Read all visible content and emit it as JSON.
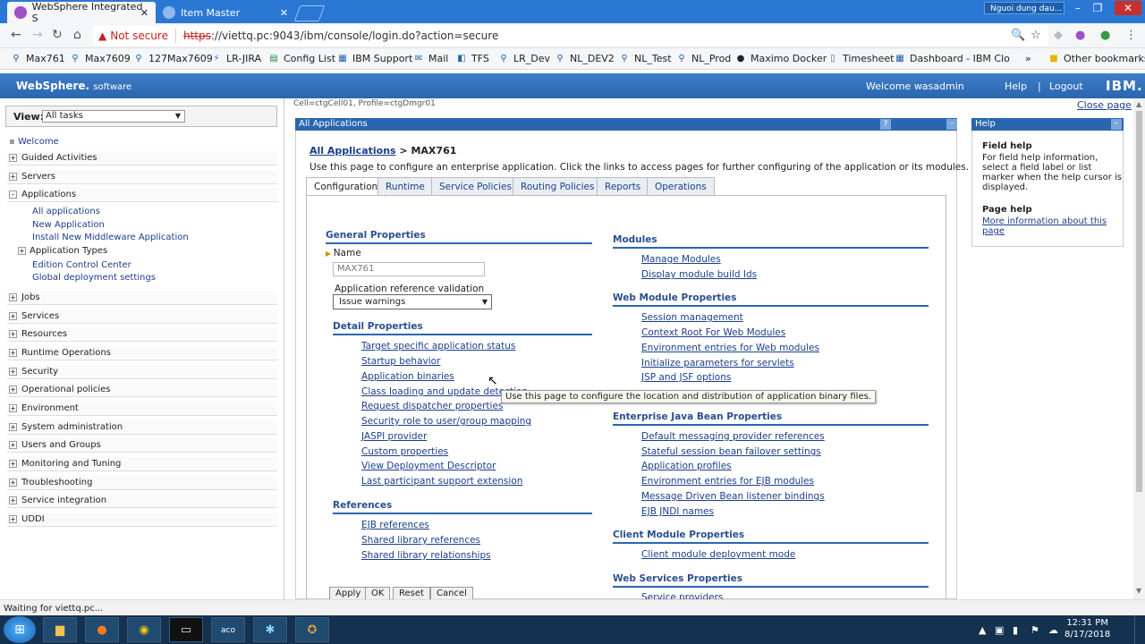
{
  "browser": {
    "tabs": [
      {
        "title": "WebSphere Integrated S",
        "active": true
      },
      {
        "title": "Item Master",
        "active": false
      }
    ],
    "profile_name": "Nguoi dung dau...",
    "security": "Not secure",
    "url_scheme": "https",
    "url_rest": "://viettq.pc:9043/ibm/console/login.do?action=secure",
    "bookmarks": [
      "Max761",
      "Max7609",
      "127Max7609",
      "LR-JIRA",
      "Config List",
      "IBM Support",
      "Mail",
      "TFS",
      "LR_Dev",
      "NL_DEV2",
      "NL_Test",
      "NL_Prod",
      "Maximo Docker",
      "Timesheet",
      "Dashboard - IBM Clo"
    ],
    "other_bookmarks": "Other bookmarks",
    "overflow": "»",
    "status": "Waiting for viettq.pc..."
  },
  "header": {
    "logo": "WebSphere.",
    "logo_sub": "software",
    "welcome": "Welcome wasadmin",
    "help": "Help",
    "divider": "|",
    "logout": "Logout",
    "ibm": "IBM."
  },
  "nav": {
    "view_label": "View:",
    "view_value": "All tasks",
    "welcome": "Welcome",
    "items": [
      "Guided Activities",
      "Servers",
      "Applications",
      "Jobs",
      "Services",
      "Resources",
      "Runtime Operations",
      "Security",
      "Operational policies",
      "Environment",
      "System administration",
      "Users and Groups",
      "Monitoring and Tuning",
      "Troubleshooting",
      "Service integration",
      "UDDI"
    ],
    "app_sub": [
      "All applications",
      "New Application",
      "Install New Middleware Application",
      "Application Types",
      "Edition Control Center",
      "Global deployment settings"
    ]
  },
  "main": {
    "cell_info": "Cell=ctgCell01, Profile=ctgDmgr01",
    "close_page": "Close page",
    "panel_title": "All Applications",
    "panel_help_btn": "?",
    "breadcrumb_link": "All Applications",
    "breadcrumb_rest": " > MAX761",
    "description": "Use this page to configure an enterprise application. Click the links to access pages for further configuring of the application or its modules.",
    "tabs": [
      "Configuration",
      "Runtime",
      "Service Policies",
      "Routing Policies",
      "Reports",
      "Operations"
    ],
    "general_properties": "General Properties",
    "name_label": "Name",
    "name_value": "MAX761",
    "arv_label": "Application reference validation",
    "arv_value": "Issue warnings",
    "detail_properties": "Detail Properties",
    "detail_links": [
      "Target specific application status",
      "Startup behavior",
      "Application binaries",
      "Class loading and update detection",
      "Request dispatcher properties",
      "Security role to user/group mapping",
      "JASPI provider",
      "Custom properties",
      "View Deployment Descriptor",
      "Last participant support extension"
    ],
    "references": "References",
    "reference_links": [
      "EJB references",
      "Shared library references",
      "Shared library relationships"
    ],
    "modules": "Modules",
    "module_links": [
      "Manage Modules",
      "Display module build Ids"
    ],
    "web_module_properties": "Web Module Properties",
    "web_links": [
      "Session management",
      "Context Root For Web Modules",
      "Environment entries for Web modules",
      "Initialize parameters for servlets",
      "JSP and JSF options"
    ],
    "ejb_properties": "Enterprise Java Bean Properties",
    "ejb_links": [
      "Default messaging provider references",
      "Stateful session bean failover settings",
      "Application profiles",
      "Environment entries for EJB modules",
      "Message Driven Bean listener bindings",
      "EJB JNDI names"
    ],
    "client_module_properties": "Client Module Properties",
    "client_links": [
      "Client module deployment mode"
    ],
    "web_services_properties": "Web Services Properties",
    "ws_links": [
      "Service providers"
    ],
    "buttons": [
      "Apply",
      "OK",
      "Reset",
      "Cancel"
    ],
    "tooltip": "Use this page to configure the location and distribution of application binary files."
  },
  "help": {
    "title": "Help",
    "field_help_title": "Field help",
    "field_help_text": "For field help information, select a field label or list marker when the help cursor is displayed.",
    "page_help_title": "Page help",
    "page_help_link": "More information about this page"
  },
  "taskbar": {
    "apps": [
      "explorer",
      "firefox",
      "chrome",
      "terminal",
      "sqlaco",
      "network",
      "game"
    ],
    "time": "12:31 PM",
    "date": "8/17/2018"
  }
}
